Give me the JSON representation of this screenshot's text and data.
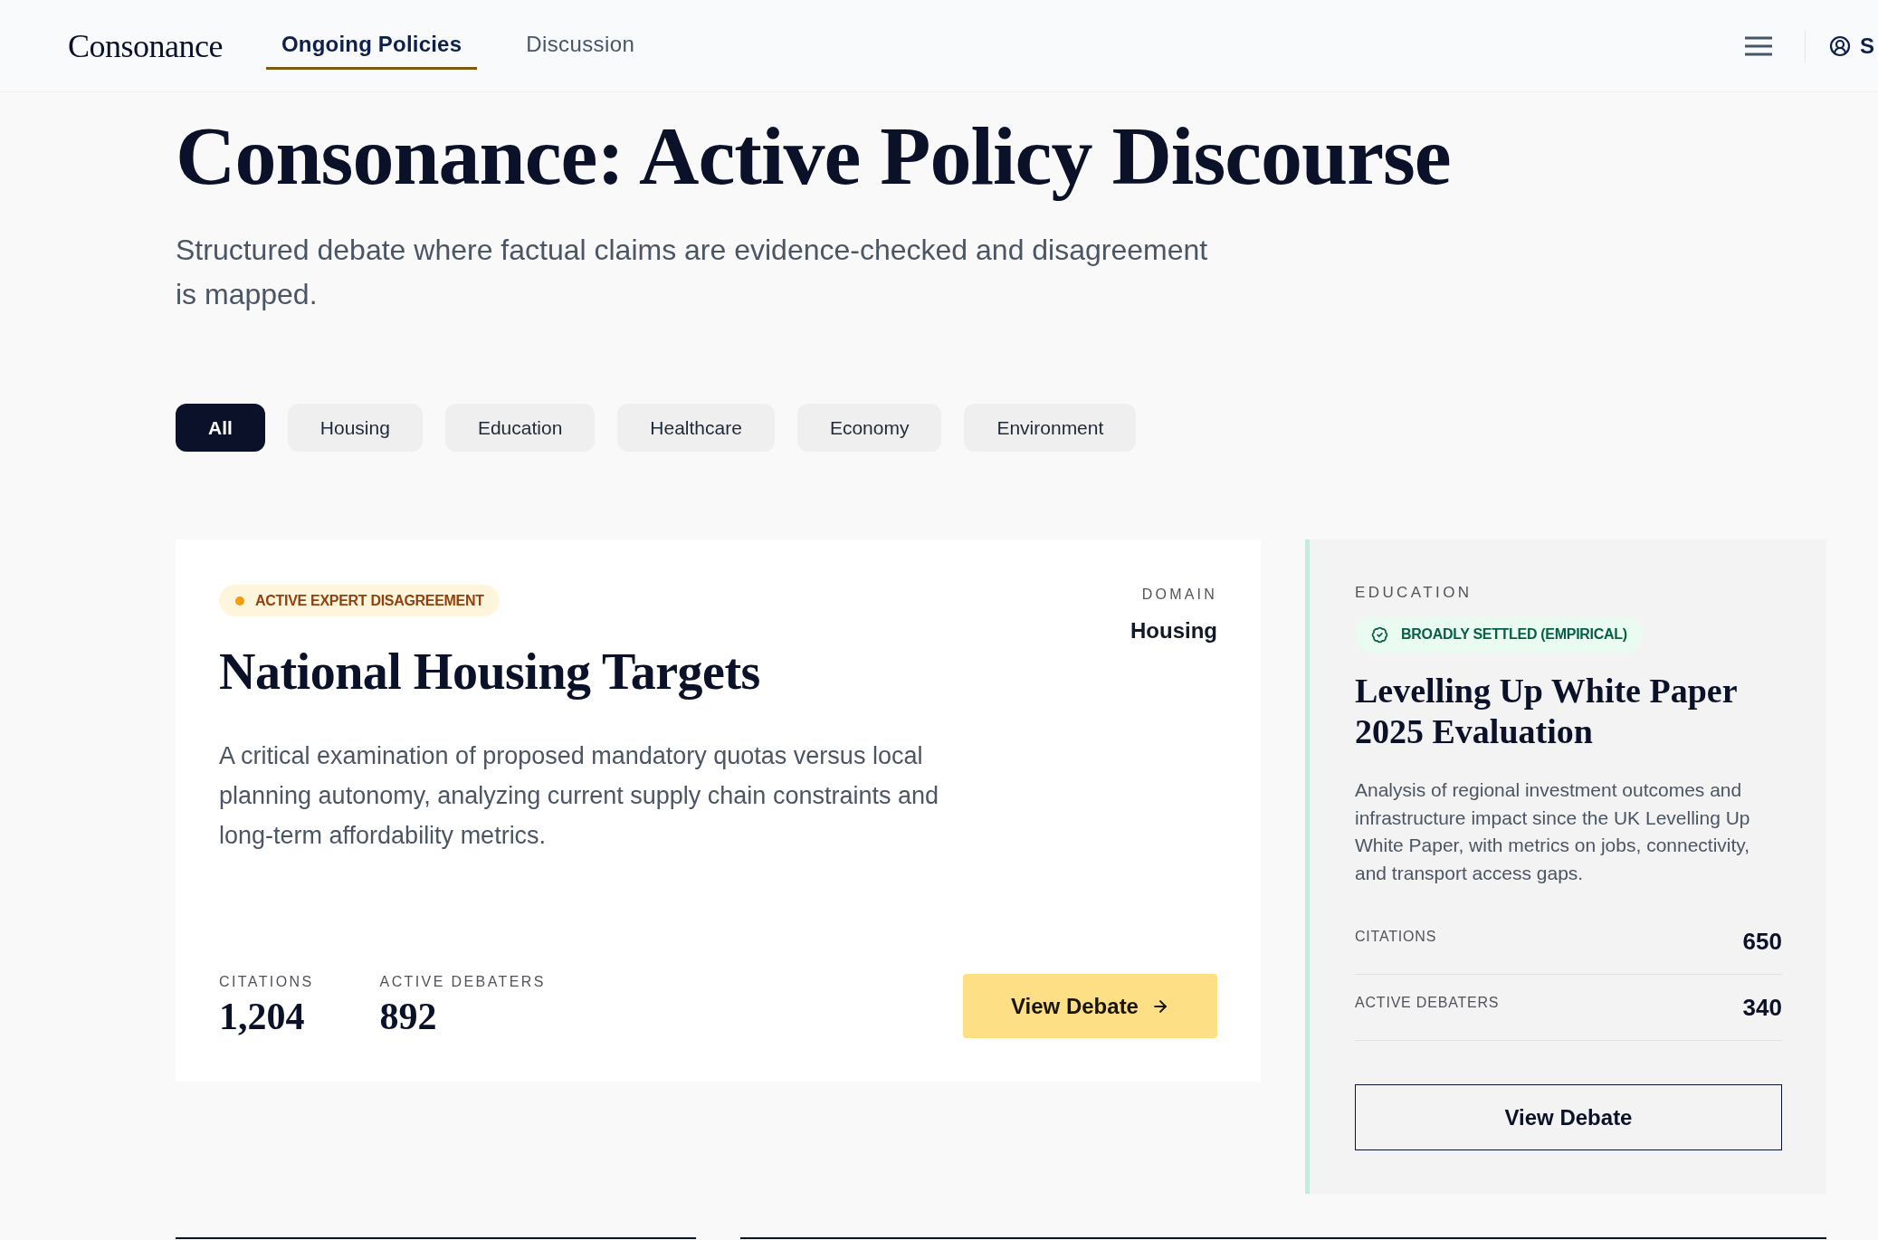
{
  "header": {
    "logo": "Consonance",
    "nav": [
      {
        "label": "Ongoing Policies",
        "selected": true
      },
      {
        "label": "Discussion",
        "selected": false
      }
    ],
    "account_label": "S"
  },
  "hero": {
    "title": "Consonance: Active Policy Discourse",
    "subtitle": "Structured debate where factual claims are evidence-checked and disagreement is mapped."
  },
  "filters": [
    {
      "label": "All",
      "selected": true
    },
    {
      "label": "Housing",
      "selected": false
    },
    {
      "label": "Education",
      "selected": false
    },
    {
      "label": "Healthcare",
      "selected": false
    },
    {
      "label": "Economy",
      "selected": false
    },
    {
      "label": "Environment",
      "selected": false
    }
  ],
  "featured": {
    "status": {
      "kind": "contested",
      "label": "ACTIVE EXPERT DISAGREEMENT"
    },
    "domain_label": "DOMAIN",
    "domain": "Housing",
    "title": "National Housing Targets",
    "description": "A critical examination of proposed mandatory quotas versus local planning autonomy, analyzing current supply chain constraints and long-term affordability metrics.",
    "stats": [
      {
        "label": "CITATIONS",
        "value": "1,204"
      },
      {
        "label": "ACTIVE DEBATERS",
        "value": "892"
      }
    ],
    "button": "View Debate"
  },
  "side_card": {
    "category": "EDUCATION",
    "status": {
      "kind": "settled",
      "label": "BROADLY SETTLED (EMPIRICAL)"
    },
    "title": "Levelling Up White Paper 2025 Evaluation",
    "description": "Analysis of regional investment outcomes and infrastructure impact since the UK Levelling Up White Paper, with metrics on jobs, connectivity, and transport access gaps.",
    "stats": [
      {
        "label": "CITATIONS",
        "value": "650"
      },
      {
        "label": "ACTIVE DEBATERS",
        "value": "340"
      }
    ],
    "button": "View Debate"
  }
}
